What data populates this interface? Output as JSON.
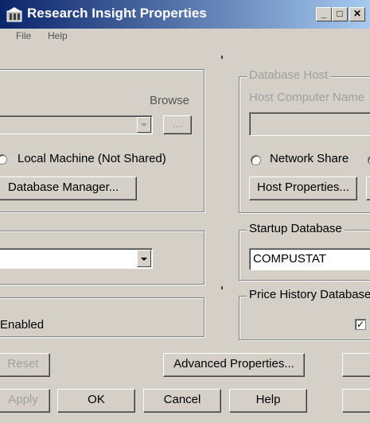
{
  "window": {
    "title": "Research Insight Properties",
    "minimize_glyph": "_",
    "maximize_glyph": "□",
    "close_glyph": "✕"
  },
  "menu": {
    "file": "File",
    "help": "Help"
  },
  "local_group": {
    "browse_label": "Browse",
    "browse_button": "...",
    "radio_local": "Local Machine (Not Shared)",
    "db_manager_button": "Database Manager..."
  },
  "database_host": {
    "legend": "Database Host",
    "host_computer_label": "Host Computer Name",
    "host_value": "",
    "radio_network": "Network Share",
    "host_properties_button": "Host Properties..."
  },
  "startup_database": {
    "legend": "Startup Database",
    "value": "COMPUSTAT"
  },
  "price_history": {
    "legend": "Price History Database"
  },
  "enabled_label": "Enabled",
  "buttons": {
    "reset": "Reset",
    "advanced": "Advanced Properties...",
    "apply": "Apply",
    "ok": "OK",
    "cancel": "Cancel",
    "help": "Help"
  }
}
